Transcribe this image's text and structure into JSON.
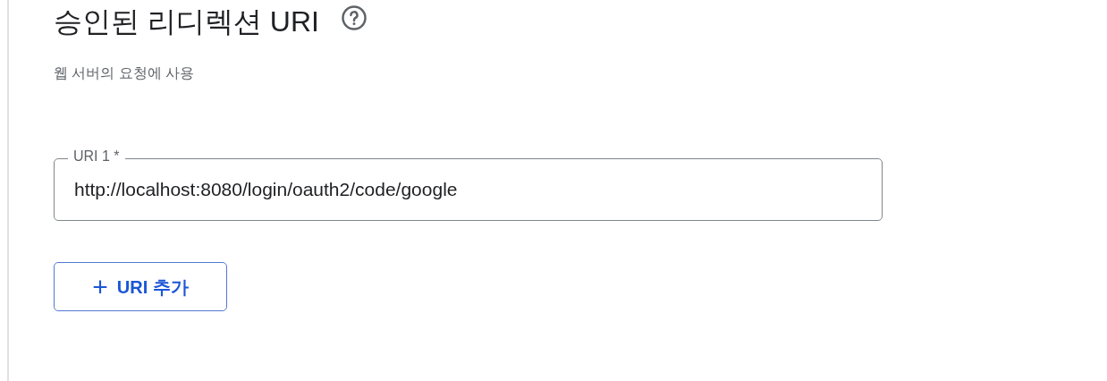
{
  "section": {
    "title": "승인된 리디렉션 URI",
    "subtitle": "웹 서버의 요청에 사용"
  },
  "fields": [
    {
      "label": "URI 1 *",
      "value": "http://localhost:8080/login/oauth2/code/google"
    }
  ],
  "add_button": {
    "icon": "+",
    "label": "URI 추가"
  }
}
